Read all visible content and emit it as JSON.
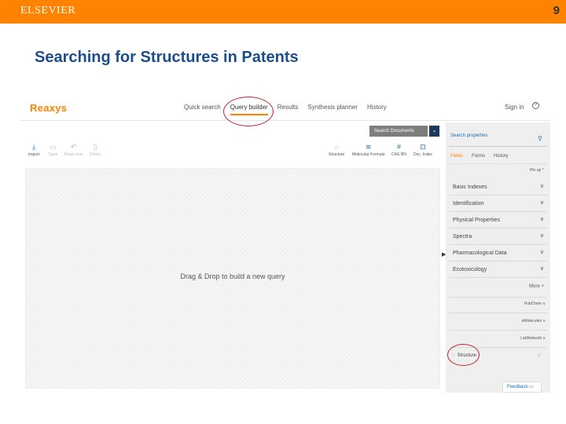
{
  "slide": {
    "brand": "ELSEVIER",
    "number": "9",
    "title": "Searching for Structures in Patents"
  },
  "reaxys": {
    "logo": "Reaxys",
    "nav": [
      "Quick search",
      "Query builder",
      "Results",
      "Synthesis planner",
      "History"
    ],
    "active_nav": "Query builder",
    "sign_in": "Sign in",
    "help_icon": "?"
  },
  "toolbar": {
    "search_button": "Search Documents",
    "search_arrow": "⌄",
    "left_tools": [
      {
        "icon": "⤓",
        "label": "Import",
        "enabled": true
      },
      {
        "icon": "▭",
        "label": "Save",
        "enabled": false
      },
      {
        "icon": "↶",
        "label": "Undo",
        "enabled": false
      },
      {
        "icon": "▯",
        "label": "Delete",
        "enabled": false
      }
    ],
    "left_tools_labels_extra": [
      "Begin new"
    ],
    "right_tools": [
      {
        "icon": "◌",
        "label": "Structure"
      },
      {
        "icon": "≋",
        "label": "Molecular Formula"
      },
      {
        "icon": "#",
        "label": "CAS RN"
      },
      {
        "icon": "⊡",
        "label": "Doc. Index"
      }
    ]
  },
  "canvas": {
    "message": "Drag & Drop to build a new query"
  },
  "sidebar": {
    "search_placeholder": "Search properties",
    "tabs": [
      "Fields",
      "Forms",
      "History"
    ],
    "active_tab": "Fields",
    "pin_label": "Pin up ^",
    "categories": [
      "Basic Indexes",
      "Identification",
      "Physical Properties",
      "Spectra",
      "Pharmacological Data",
      "Ecotoxicology"
    ],
    "more_label": "More +",
    "sub_sections": [
      "PubChem ∨",
      "eMolecules ∨",
      "LabNetwork ∨"
    ],
    "structure_item": "Structure",
    "feedback": "Feedback"
  },
  "annotations": {
    "color": "#c0252b"
  },
  "colors": {
    "brand_orange": "#ff8200",
    "title_blue": "#1c4e8c",
    "link_blue": "#1a6bb0"
  }
}
